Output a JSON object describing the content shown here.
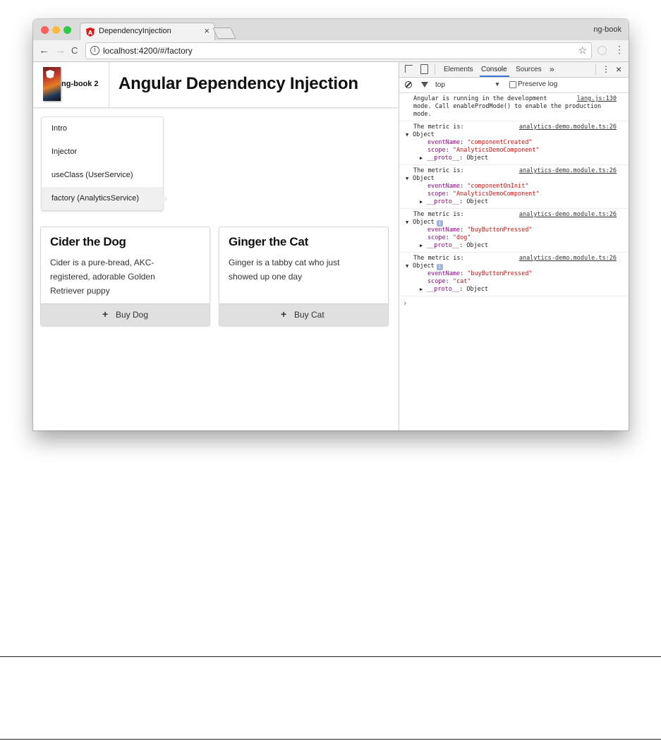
{
  "browser": {
    "tab_title": "DependencyInjection",
    "tab_close": "×",
    "profile": "ng-book",
    "url": "localhost:4200/#/factory",
    "nav": {
      "back": "←",
      "forward": "→",
      "reload": "C"
    },
    "star": "☆",
    "menu": "⋮",
    "info": "i",
    "traffic_colors": [
      "#fc605c",
      "#fdbc40",
      "#34c84a"
    ]
  },
  "app": {
    "brand": "ng-book 2",
    "title": "Angular Dependency Injection",
    "menu_items": [
      {
        "label": "Intro"
      },
      {
        "label": "Injector"
      },
      {
        "label": "useClass (UserService)"
      },
      {
        "label": "factory (AnalyticsService)",
        "active": true
      }
    ],
    "cards": [
      {
        "title": "Cider the Dog",
        "text": "Cider is a pure-bread, AKC-registered, adorable Golden Retriever puppy",
        "button": "Buy Dog"
      },
      {
        "title": "Ginger the Cat",
        "text": "Ginger is a tabby cat who just showed up one day",
        "button": "Buy Cat"
      }
    ],
    "plus": "+"
  },
  "devtools": {
    "tabs": [
      "Elements",
      "Console",
      "Sources"
    ],
    "more": "»",
    "kebab": "⋮",
    "close": "×",
    "context": "top",
    "context_arrow": "▼",
    "preserve_log": "Preserve log",
    "intro": {
      "lines": [
        "Angular is running in the development",
        "mode. Call enableProdMode() to enable the production",
        "mode."
      ],
      "source": "lang.js:130"
    },
    "metric_label": "The metric is:",
    "metric_source": "analytics-demo.module.ts:26",
    "object_label": "Object",
    "proto_key": "__proto__",
    "proto_val": "Object",
    "keys": {
      "event": "eventName",
      "scope": "scope"
    },
    "metrics": [
      {
        "eventName": "\"componentCreated\"",
        "scope": "\"AnalyticsDemoComponent\"",
        "badge": false
      },
      {
        "eventName": "\"componentOnInit\"",
        "scope": "\"AnalyticsDemoComponent\"",
        "badge": false
      },
      {
        "eventName": "\"buyButtonPressed\"",
        "scope": "\"dog\"",
        "badge": true
      },
      {
        "eventName": "\"buyButtonPressed\"",
        "scope": "\"cat\"",
        "badge": true
      }
    ],
    "badge_text": "i",
    "prompt": "›",
    "accent": "#3879d9"
  }
}
